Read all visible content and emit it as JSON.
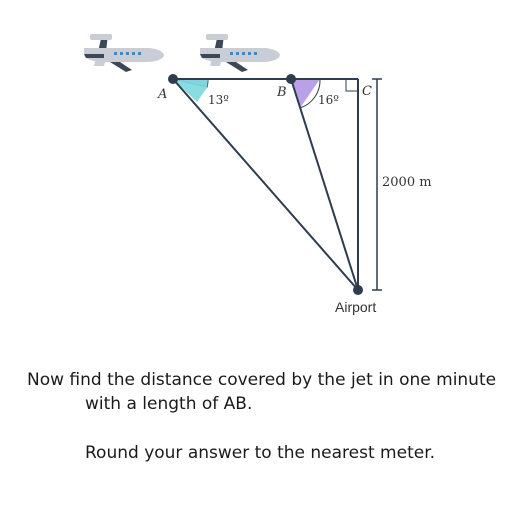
{
  "diagram": {
    "points": {
      "a": "A",
      "b": "B",
      "c": "C"
    },
    "angles": {
      "at_a": "13º",
      "at_b": "16º"
    },
    "height_label": "2000 m",
    "airport_label": "Airport"
  },
  "question": {
    "line1": "Now find the distance covered by the jet in one minute",
    "line2": "with a length of AB.",
    "instruction": "Round your answer to the nearest meter."
  },
  "colors": {
    "line": "#2e3c4d",
    "angle_a_fill": "#7dd8e0",
    "angle_b_fill": "#b9a1e8",
    "jet_body": "#c9ced6",
    "jet_dark": "#3d4856",
    "jet_windows": "#2a8fd6"
  }
}
